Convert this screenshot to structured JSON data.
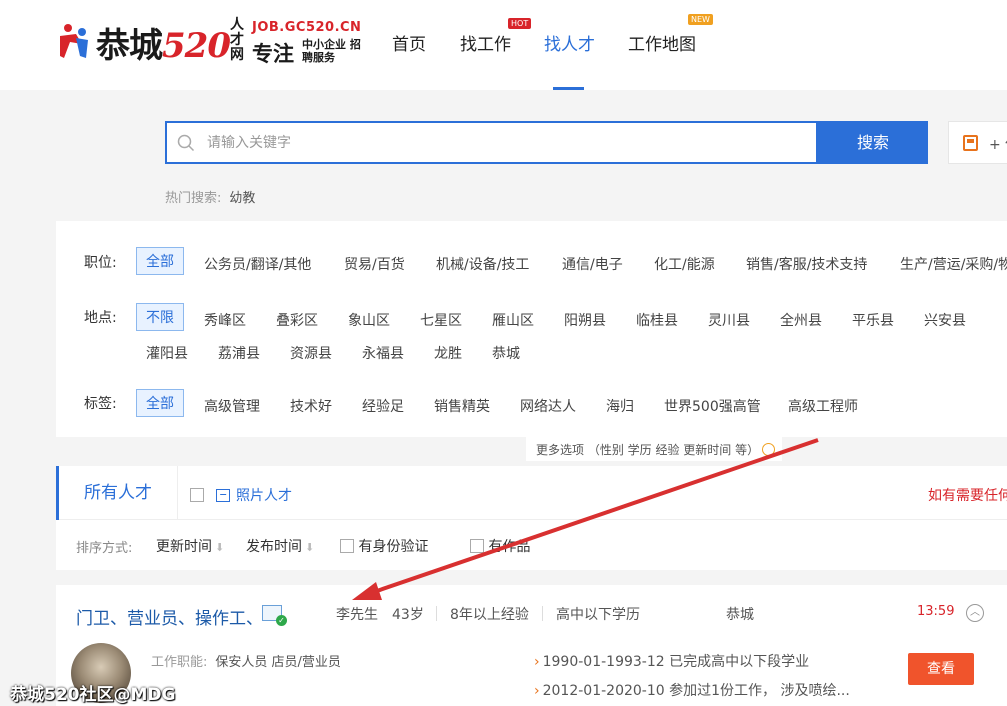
{
  "logo": {
    "brand": "恭城",
    "brand_num": "520",
    "rencai": "人才网",
    "site": "JOB.GC520.CN",
    "slogan_main": "专注",
    "slogan_sub": "中小企业 招聘服务"
  },
  "nav": {
    "items": [
      {
        "label": "首页"
      },
      {
        "label": "找工作",
        "badge": "HOT"
      },
      {
        "label": "找人才"
      },
      {
        "label": "工作地图",
        "badge": "NEW"
      }
    ],
    "active": "找人才"
  },
  "search": {
    "placeholder": "请输入关键字",
    "button": "搜索",
    "save_label": "+ 保"
  },
  "hot_search": {
    "label": "热门搜索:",
    "keywords": [
      "幼教"
    ]
  },
  "filters": {
    "position": {
      "label": "职位:",
      "options": [
        "全部",
        "公务员/翻译/其他",
        "贸易/百货",
        "机械/设备/技工",
        "通信/电子",
        "化工/能源",
        "销售/客服/技术支持",
        "生产/营运/采购/物"
      ],
      "selected": "全部"
    },
    "location": {
      "label": "地点:",
      "options": [
        "不限",
        "秀峰区",
        "叠彩区",
        "象山区",
        "七星区",
        "雁山区",
        "阳朔县",
        "临桂县",
        "灵川县",
        "全州县",
        "平乐县",
        "兴安县",
        "灌阳县",
        "荔浦县",
        "资源县",
        "永福县",
        "龙胜",
        "恭城"
      ],
      "selected": "不限"
    },
    "tags": {
      "label": "标签:",
      "options": [
        "全部",
        "高级管理",
        "技术好",
        "经验足",
        "销售精英",
        "网络达人",
        "海归",
        "世界500强高管",
        "高级工程师"
      ],
      "selected": "全部"
    },
    "more_options": "更多选项 （性别 学历 经验 更新时间 等）"
  },
  "tabs": {
    "all": "所有人才",
    "photo": "照片人才",
    "notice": "如有需要任何"
  },
  "sort": {
    "label": "排序方式:",
    "options": [
      "更新时间",
      "发布时间"
    ],
    "checkboxes": [
      "有身份验证",
      "有作品"
    ]
  },
  "resume": {
    "title": "门卫、营业员、操作工、",
    "name": "李先生",
    "age": "43岁",
    "experience": "8年以上经验",
    "education": "高中以下学历",
    "location": "恭城",
    "time": "13:59",
    "job_func_label": "工作职能:",
    "job_func": "保安人员 店员/营业员",
    "history": [
      "1990-01-1993-12 已完成高中以下段学业",
      "2012-01-2020-10 参加过1份工作， 涉及喷绘..."
    ],
    "view_button": "查看"
  },
  "watermark": "恭城520社区@MDG",
  "colors": {
    "accent": "#2b6fd8",
    "brand_red": "#d8242a",
    "view_button": "#f0542c",
    "arrow": "#d83030"
  }
}
